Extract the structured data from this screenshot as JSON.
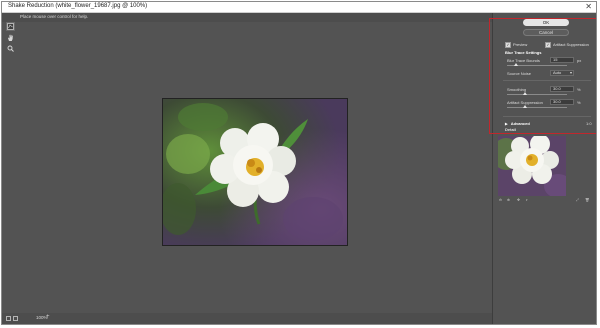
{
  "window": {
    "title": "Shake Reduction (white_flower_19687.jpg @ 100%)",
    "close_glyph": "✕",
    "hint": "Place mouse over control for help."
  },
  "toolbar": {
    "tools": [
      {
        "name": "blur-trace-tool",
        "icon": "blur-trace-icon"
      },
      {
        "name": "hand-tool",
        "icon": "hand-icon"
      },
      {
        "name": "zoom-tool",
        "icon": "zoom-icon"
      }
    ]
  },
  "panel": {
    "ok_label": "OK",
    "cancel_label": "Cancel",
    "preview_label": "Preview",
    "artifact_label": "Artifact Suppression",
    "section_title": "Blur Trace Settings",
    "blur_trace_bounds_label": "Blur Trace Bounds",
    "blur_trace_bounds_value": "15",
    "blur_trace_bounds_unit": "px",
    "source_noise_label": "Source Noise",
    "source_noise_value": "Auto",
    "smoothing_label": "Smoothing",
    "smoothing_value": "30.0",
    "smoothing_unit": "%",
    "artifact_suppression_label": "Artifact Suppression",
    "artifact_suppression_value": "30.0",
    "artifact_suppression_unit": "%",
    "advanced_label": "Advanced",
    "advanced_value": "1:0",
    "detail_label": "Detail"
  },
  "sliders": {
    "blur_trace_bounds_fraction": 0.15,
    "smoothing_fraction": 0.3,
    "artifact_suppression_fraction": 0.3
  },
  "bottombar": {
    "zoom": "100%",
    "plus": "+"
  },
  "colors": {
    "highlight": "#c1272d",
    "window_bg": "#535353"
  }
}
